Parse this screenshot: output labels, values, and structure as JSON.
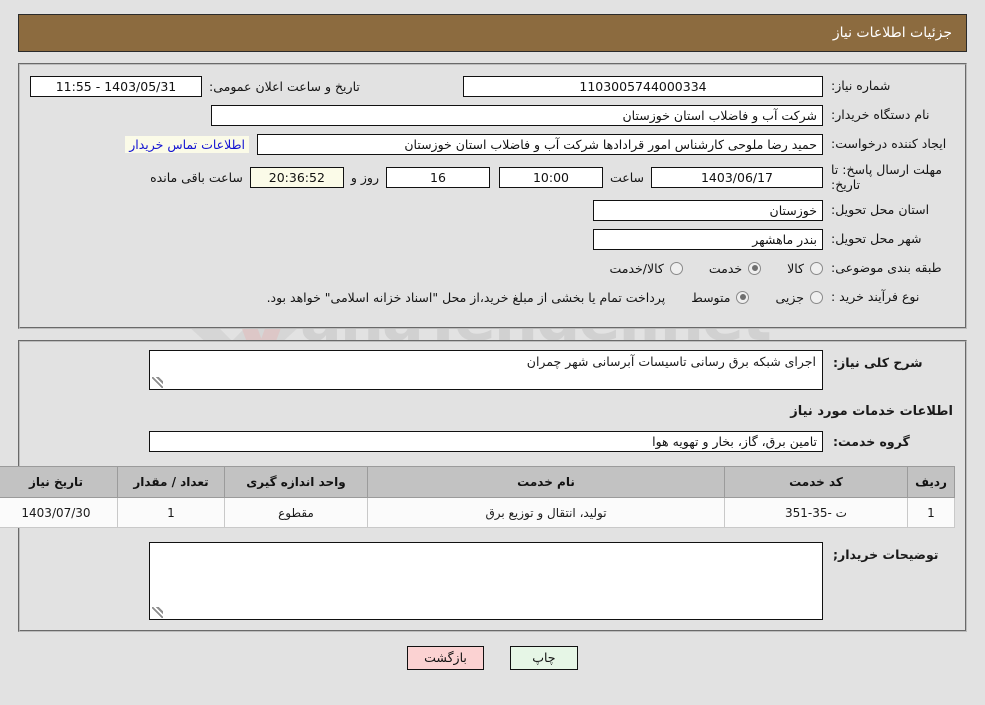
{
  "header": {
    "title": "جزئیات اطلاعات نیاز"
  },
  "form": {
    "need_number_label": "شماره نیاز:",
    "need_number_value": "1103005744000334",
    "announce_label": "تاریخ و ساعت اعلان عمومی:",
    "announce_value": "1403/05/31 - 11:55",
    "buyer_org_label": "نام دستگاه خریدار:",
    "buyer_org_value": "شرکت آب و فاضلاب استان خوزستان",
    "creator_label": "ایجاد کننده درخواست:",
    "creator_value": "حمید رضا ملوحی کارشناس امور قرادادها شرکت آب و فاضلاب استان خوزستان",
    "contact_link": "اطلاعات تماس خریدار",
    "deadline_label": "مهلت ارسال پاسخ: تا تاریخ:",
    "deadline_date": "1403/06/17",
    "hour_label": "ساعت",
    "hour_value": "10:00",
    "days_value": "16",
    "days_text": "روز و",
    "remaining_value": "20:36:52",
    "remaining_text": "ساعت باقی مانده",
    "province_label": "استان محل تحویل:",
    "province_value": "خوزستان",
    "city_label": "شهر محل تحویل:",
    "city_value": "بندر ماهشهر",
    "category_label": "طبقه بندی موضوعی:",
    "category_options": [
      {
        "label": "کالا",
        "selected": false
      },
      {
        "label": "خدمت",
        "selected": true
      },
      {
        "label": "کالا/خدمت",
        "selected": false
      }
    ],
    "process_label": "نوع فرآیند خرید :",
    "process_options": [
      {
        "label": "جزیی",
        "selected": false
      },
      {
        "label": "متوسط",
        "selected": true
      }
    ],
    "payment_note": "پرداخت تمام یا بخشی از مبلغ خرید،از محل \"اسناد خزانه اسلامی\" خواهد بود."
  },
  "description": {
    "label": "شرح کلی نیاز:",
    "value": "اجرای شبکه برق رسانی تاسیسات آبرسانی شهر چمران"
  },
  "services": {
    "section_title": "اطلاعات خدمات مورد نیاز",
    "group_label": "گروه خدمت:",
    "group_value": "تامین برق، گاز، بخار و تهویه هوا",
    "columns": [
      "ردیف",
      "کد خدمت",
      "نام خدمت",
      "واحد اندازه گیری",
      "تعداد / مقدار",
      "تاریخ نیاز"
    ],
    "rows": [
      {
        "row": "1",
        "code": "ت -35-351",
        "name": "تولید، انتقال و توزیع برق",
        "unit": "مقطوع",
        "quantity": "1",
        "date": "1403/07/30"
      }
    ]
  },
  "buyer_notes": {
    "label": "توضیحات خریدار;",
    "value": ""
  },
  "footer": {
    "print_label": "چاپ",
    "back_label": "بازگشت"
  },
  "watermark": {
    "brand": "anaTender.net",
    "mark": "V"
  },
  "colors": {
    "title_bar": "#8c6b3f",
    "page_bg": "#e2e2e2",
    "link": "#1414d2",
    "highlight_field": "#fbfbe8",
    "table_header": "#c2c2c2",
    "print_button": "#e6f6e6",
    "back_button": "#fbd2d2"
  }
}
